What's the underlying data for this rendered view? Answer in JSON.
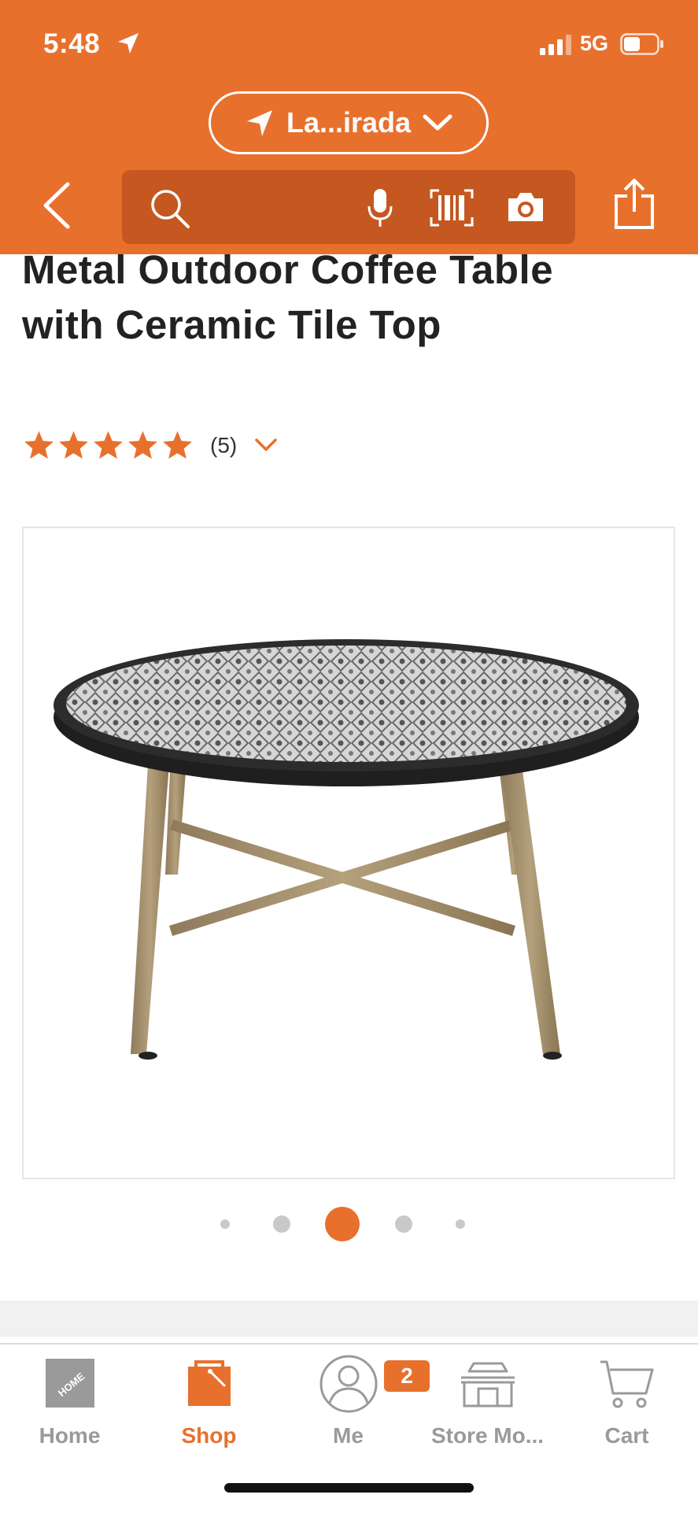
{
  "status_bar": {
    "time": "5:48",
    "network": "5G"
  },
  "location": {
    "label": "La...irada"
  },
  "search": {
    "placeholder": ""
  },
  "product": {
    "title": "Metal Outdoor Coffee Table with Ceramic Tile Top",
    "rating": 5,
    "review_count": "(5)",
    "image_alt": "Round coffee table with patterned tile top and wood-look legs"
  },
  "carousel": {
    "count": 5,
    "active": 2
  },
  "tabbar": {
    "items": [
      {
        "label": "Home",
        "icon": "home-depot-logo-icon"
      },
      {
        "label": "Shop",
        "icon": "shop-bag-icon"
      },
      {
        "label": "Me",
        "icon": "user-icon"
      },
      {
        "label": "Store Mo...",
        "icon": "store-icon"
      },
      {
        "label": "Cart",
        "icon": "cart-icon"
      }
    ],
    "badge": "2"
  },
  "colors": {
    "brand": "#E8702D",
    "search_bg": "#C45820"
  }
}
